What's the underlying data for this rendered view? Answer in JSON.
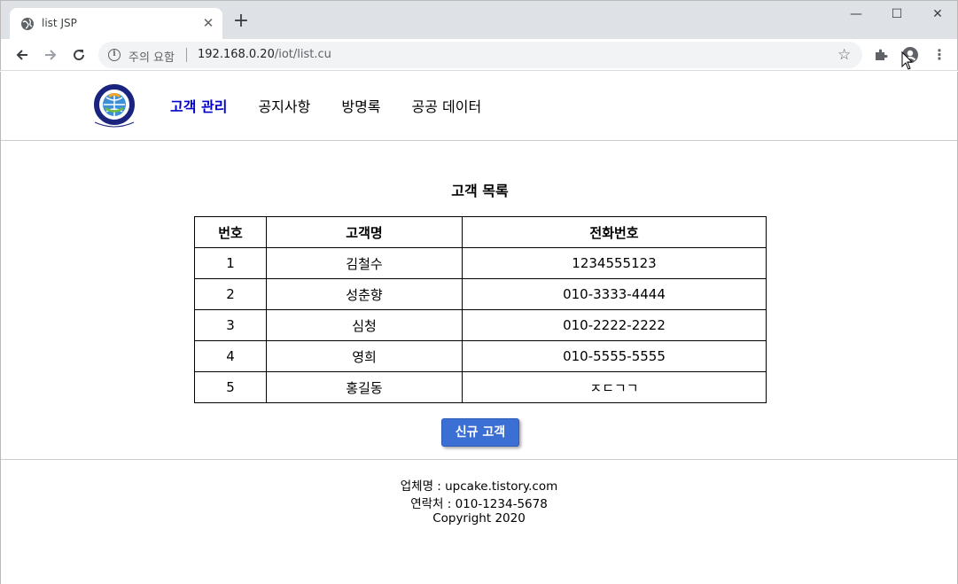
{
  "browser": {
    "tab_title": "list JSP",
    "tab_close": "✕",
    "new_tab": "+",
    "window_min": "—",
    "window_max": "☐",
    "window_close": "✕",
    "security_label": "주의 요함",
    "url_host": "192.168.0.20",
    "url_path": "/iot/list.cu",
    "icons": [
      "globe-icon",
      "back-arrow-icon",
      "forward-arrow-icon",
      "reload-icon",
      "info-icon",
      "star-icon",
      "puzzle-extension-icon",
      "profile-icon",
      "kebab-menu-icon"
    ]
  },
  "header": {
    "nav": [
      "고객 관리",
      "공지사항",
      "방명록",
      "공공 데이터"
    ],
    "active_index": 0
  },
  "main": {
    "title": "고객 목록",
    "columns": [
      "번호",
      "고객명",
      "전화번호"
    ],
    "rows": [
      [
        "1",
        "김철수",
        "1234555123"
      ],
      [
        "2",
        "성춘향",
        "010-3333-4444"
      ],
      [
        "3",
        "심청",
        "010-2222-2222"
      ],
      [
        "4",
        "영희",
        "010-5555-5555"
      ],
      [
        "5",
        "홍길동",
        "ㅈㄷㄱㄱ"
      ]
    ],
    "new_button": "신규 고객"
  },
  "footer": {
    "company": "업체명 : upcake.tistory.com",
    "contact": "연락처 : 010-1234-5678",
    "copyright": "Copyright 2020"
  },
  "colors": {
    "active_nav": "#0000cd",
    "button_bg": "#3b6fd4",
    "tab_bar": "#dee1e6",
    "omnibox": "#f1f3f4"
  }
}
